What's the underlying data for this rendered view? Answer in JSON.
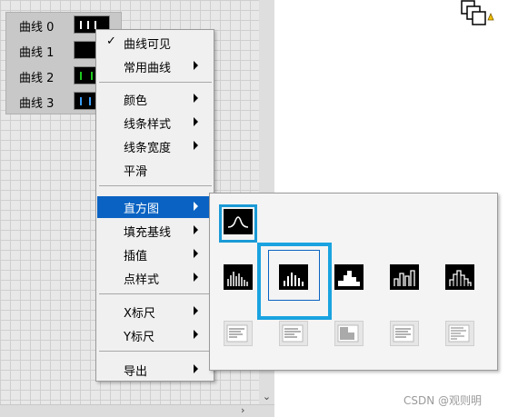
{
  "plots": [
    {
      "label": "曲线 0"
    },
    {
      "label": "曲线 1"
    },
    {
      "label": "曲线 2"
    },
    {
      "label": "曲线 3"
    }
  ],
  "menu": {
    "items": [
      {
        "label": "曲线可见",
        "check": "✓"
      },
      {
        "label": "常用曲线"
      },
      {
        "label": "颜色"
      },
      {
        "label": "线条样式"
      },
      {
        "label": "线条宽度"
      },
      {
        "label": "平滑"
      },
      {
        "label": "直方图"
      },
      {
        "label": "填充基线"
      },
      {
        "label": "插值"
      },
      {
        "label": "点样式"
      },
      {
        "label": "X标尺"
      },
      {
        "label": "Y标尺"
      },
      {
        "label": "导出"
      }
    ]
  },
  "palette": {
    "rows": [
      {
        "icons": [
          "curve-no-histogram"
        ]
      },
      {
        "icons": [
          "histogram-bars-1",
          "histogram-bars-2",
          "histogram-steps",
          "histogram-bars-3",
          "histogram-bars-4"
        ]
      },
      {
        "icons": [
          "histogram-horizontal-1",
          "histogram-horizontal-2",
          "histogram-horizontal-3",
          "histogram-horizontal-4",
          "histogram-horizontal-5"
        ]
      }
    ]
  },
  "colors": {
    "highlight": "#0a63c2",
    "selection": "#1aa3e0"
  },
  "watermark": "CSDN @观则明"
}
